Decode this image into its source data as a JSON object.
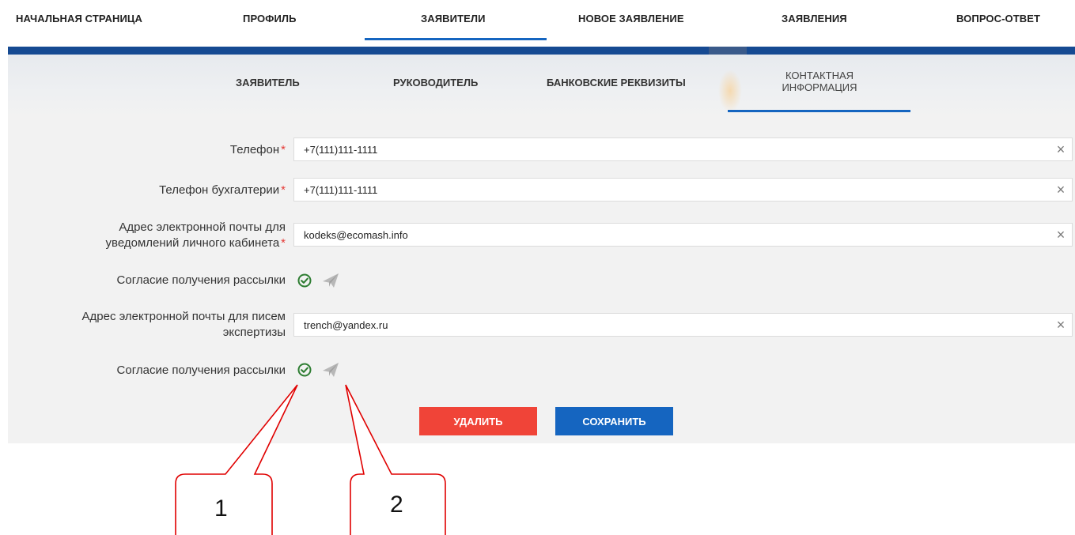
{
  "topnav": {
    "items": [
      "НАЧАЛЬНАЯ СТРАНИЦА",
      "ПРОФИЛЬ",
      "ЗАЯВИТЕЛИ",
      "НОВОЕ ЗАЯВЛЕНИЕ",
      "ЗАЯВЛЕНИЯ",
      "ВОПРОС-ОТВЕТ"
    ],
    "active": "ЗАЯВИТЕЛИ"
  },
  "subnav": {
    "items": [
      "ЗАЯВИТЕЛЬ",
      "РУКОВОДИТЕЛЬ",
      "БАНКОВСКИЕ РЕКВИЗИТЫ",
      "КОНТАКТНАЯ",
      "ИНФОРМАЦИЯ"
    ],
    "active": "КОНТАКТНАЯ ИНФОРМАЦИЯ"
  },
  "form": {
    "phone": {
      "label": "Телефон",
      "required_mark": "*",
      "value": "+7(111)111-1111"
    },
    "accounting_phone": {
      "label": "Телефон бухгалтерии",
      "required_mark": "*",
      "value": "+7(111)111-1111"
    },
    "notify_email": {
      "label_line1": "Адрес электронной почты для",
      "label_line2": "уведомлений личного кабинета",
      "required_mark": "*",
      "value": "kodeks@ecomash.info"
    },
    "consent_1": {
      "label": "Согласие получения рассылки",
      "icons": [
        "check-circle-icon",
        "paper-plane-icon"
      ]
    },
    "expertise_email": {
      "label_line1": "Адрес электронной почты для писем",
      "label_line2": "экспертизы",
      "value": "trench@yandex.ru"
    },
    "consent_2": {
      "label": "Согласие получения рассылки",
      "icons": [
        "check-circle-icon",
        "paper-plane-icon"
      ]
    },
    "clear_icon": "×"
  },
  "buttons": {
    "delete": "УДАЛИТЬ",
    "save": "СОХРАНИТЬ"
  },
  "callouts": [
    "1",
    "2"
  ],
  "colors": {
    "accent": "#1565c0",
    "danger": "#f04438",
    "required": "#e53935",
    "ok": "#2e7d32",
    "callout": "#e00000"
  }
}
